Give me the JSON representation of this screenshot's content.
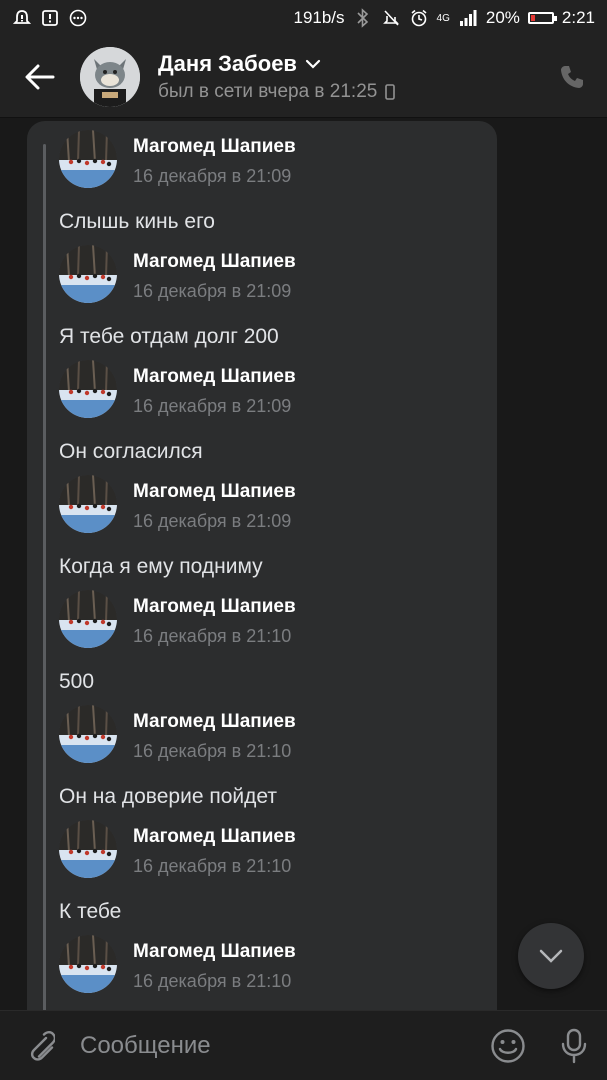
{
  "status_bar": {
    "speed": "191b/s",
    "network": "4G",
    "battery": "20%",
    "battery_level": 0.2,
    "time": "2:21",
    "icons": [
      "alarm-alert-icon",
      "warning-icon",
      "more-dots-icon",
      "bluetooth-icon",
      "mute-icon",
      "alarm-clock-icon",
      "signal-icon",
      "battery-icon"
    ]
  },
  "header": {
    "contact_name": "Даня Забоев",
    "status": "был в сети вчера в 21:25",
    "icons": [
      "back-arrow-icon",
      "chevron-down-icon",
      "mobile-device-icon",
      "phone-icon"
    ]
  },
  "colors": {
    "background": "#191919",
    "bubble": "#2c2d2e",
    "header": "#222222",
    "muted_text": "#7b7d80"
  },
  "messages": [
    {
      "author": "Магомед Шапиев",
      "date": "16 декабря в 21:09",
      "text": "Слышь кинь его"
    },
    {
      "author": "Магомед Шапиев",
      "date": "16 декабря в 21:09",
      "text": "Я тебе отдам долг 200"
    },
    {
      "author": "Магомед Шапиев",
      "date": "16 декабря в 21:09",
      "text": "Он согласился"
    },
    {
      "author": "Магомед Шапиев",
      "date": "16 декабря в 21:09",
      "text": "Когда я ему подниму"
    },
    {
      "author": "Магомед Шапиев",
      "date": "16 декабря в 21:10",
      "text": "500"
    },
    {
      "author": "Магомед Шапиев",
      "date": "16 декабря в 21:10",
      "text": "Он на доверие пойдет"
    },
    {
      "author": "Магомед Шапиев",
      "date": "16 декабря в 21:10",
      "text": "К тебе"
    },
    {
      "author": "Магомед Шапиев",
      "date": "16 декабря в 21:10",
      "text": ""
    }
  ],
  "composer": {
    "placeholder": "Сообщение",
    "icons": [
      "paperclip-icon",
      "emoji-icon",
      "microphone-icon"
    ]
  },
  "scroll_down_icon": "chevron-down-icon"
}
